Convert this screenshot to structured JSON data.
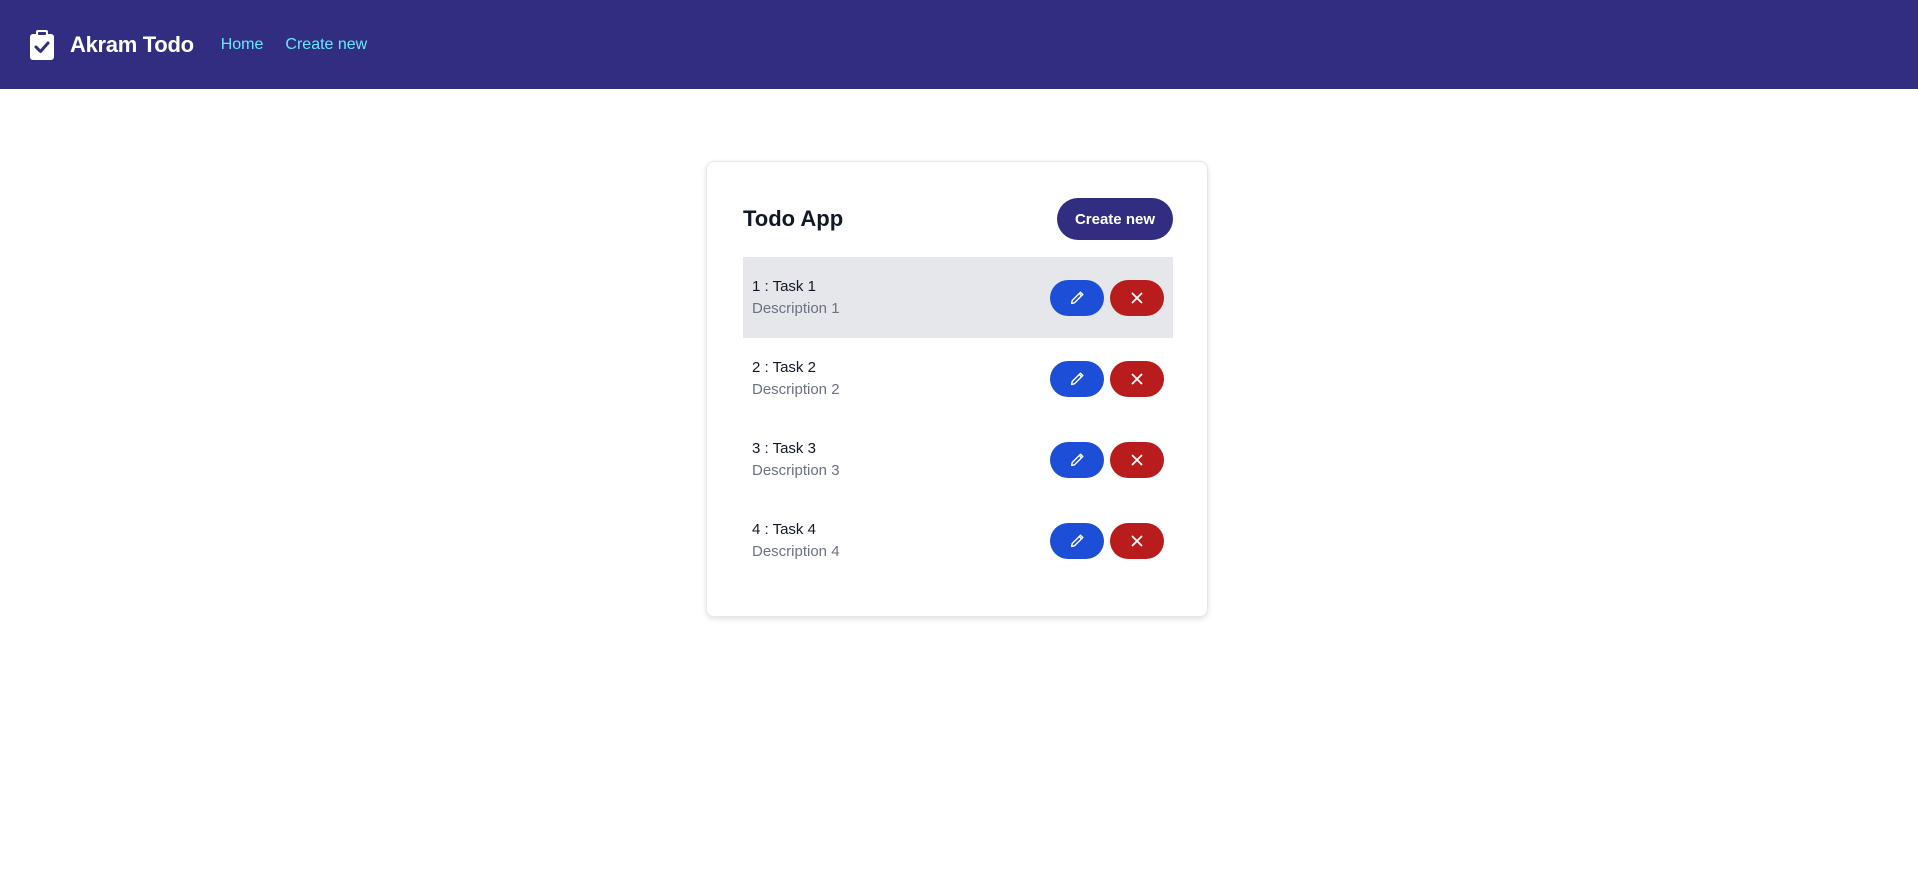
{
  "navbar": {
    "brand": "Akram Todo",
    "brand_icon": "clipboard-check-icon",
    "links": [
      {
        "label": "Home"
      },
      {
        "label": "Create new"
      }
    ],
    "colors": {
      "background": "#312e81",
      "link": "#67e8f9"
    }
  },
  "card": {
    "title": "Todo App",
    "create_button": "Create new",
    "todos": [
      {
        "title": "1 : Task 1",
        "description": "Description 1"
      },
      {
        "title": "2 : Task 2",
        "description": "Description 2"
      },
      {
        "title": "3 : Task 3",
        "description": "Description 3"
      },
      {
        "title": "4 : Task 4",
        "description": "Description 4"
      }
    ],
    "edit_icon": "pencil-icon",
    "delete_icon": "close-icon",
    "colors": {
      "edit": "#1d4ed8",
      "delete": "#b91c1c",
      "highlight_row": "#e5e7eb"
    }
  }
}
